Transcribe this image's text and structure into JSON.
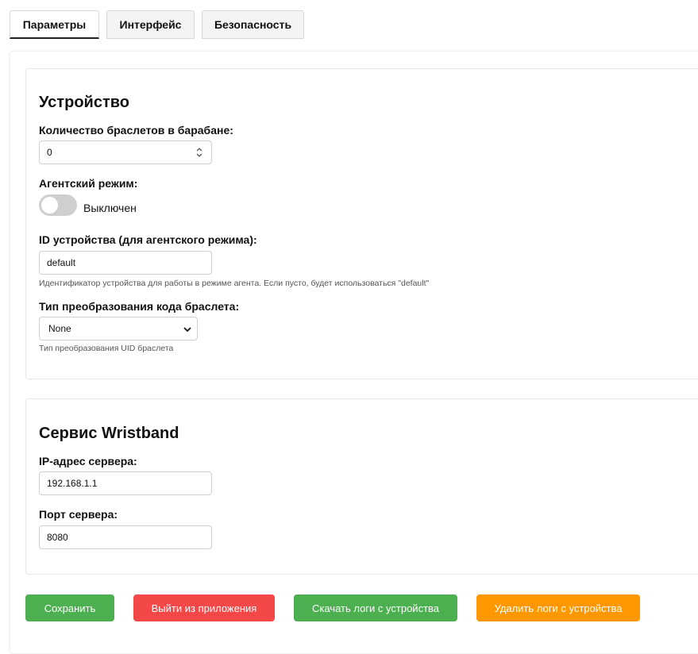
{
  "tabs": [
    {
      "label": "Параметры",
      "active": true
    },
    {
      "label": "Интерфейс",
      "active": false
    },
    {
      "label": "Безопасность",
      "active": false
    }
  ],
  "device": {
    "title": "Устройство",
    "bracelet_count_label": "Количество браслетов в барабане:",
    "bracelet_count_value": "0",
    "agent_mode_label": "Агентский режим:",
    "agent_mode_state": "Выключен",
    "device_id_label": "ID устройства (для агентского режима):",
    "device_id_value": "default",
    "device_id_hint": "Идентификатор устройства для работы в режиме агента. Если пусто, будет использоваться \"default\"",
    "conversion_label": "Тип преобразования кода браслета:",
    "conversion_value": "None",
    "conversion_hint": "Тип преобразования UID браслета"
  },
  "wristband": {
    "title": "Сервис Wristband",
    "server_ip_label": "IP-адрес сервера:",
    "server_ip_value": "192.168.1.1",
    "server_port_label": "Порт сервера:",
    "server_port_value": "8080"
  },
  "actions": {
    "save": "Сохранить",
    "exit": "Выйти из приложения",
    "download_logs": "Скачать логи с устройства",
    "delete_logs": "Удалить логи с устройства"
  },
  "colors": {
    "save": "#4caf50",
    "exit": "#f44848",
    "download_logs": "#4caf50",
    "delete_logs": "#ff9800"
  }
}
